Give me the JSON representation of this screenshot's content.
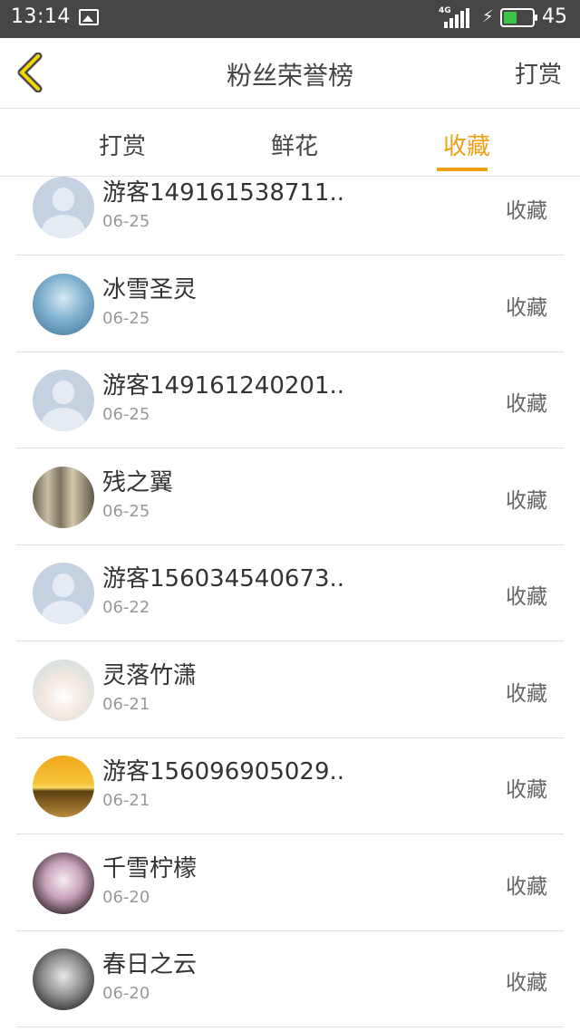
{
  "status_bar": {
    "time": "13:14",
    "network": "4G",
    "battery_percent": "45",
    "battery_level": 0.45,
    "battery_color": "#3cc44a",
    "icons": [
      "image-icon",
      "signal-icon",
      "charging-icon",
      "battery-icon"
    ]
  },
  "header": {
    "back_icon": "chevron-left-icon",
    "title": "粉丝荣誉榜",
    "action_label": "打赏"
  },
  "tabs": [
    {
      "label": "打赏",
      "active": false
    },
    {
      "label": "鲜花",
      "active": false
    },
    {
      "label": "收藏",
      "active": true
    }
  ],
  "accent_color": "#f1a016",
  "fans": [
    {
      "name": "游客149161538711..",
      "date": "06-25",
      "label": "收藏",
      "avatar": "default"
    },
    {
      "name": "冰雪圣灵",
      "date": "06-25",
      "label": "收藏",
      "avatar": "a1"
    },
    {
      "name": "游客149161240201..",
      "date": "06-25",
      "label": "收藏",
      "avatar": "default"
    },
    {
      "name": "残之翼",
      "date": "06-25",
      "label": "收藏",
      "avatar": "a2"
    },
    {
      "name": "游客156034540673..",
      "date": "06-22",
      "label": "收藏",
      "avatar": "default"
    },
    {
      "name": "灵落竹潇",
      "date": "06-21",
      "label": "收藏",
      "avatar": "a3"
    },
    {
      "name": "游客156096905029..",
      "date": "06-21",
      "label": "收藏",
      "avatar": "a4"
    },
    {
      "name": "千雪柠檬",
      "date": "06-20",
      "label": "收藏",
      "avatar": "a5"
    },
    {
      "name": "春日之云",
      "date": "06-20",
      "label": "收藏",
      "avatar": "a6"
    }
  ]
}
